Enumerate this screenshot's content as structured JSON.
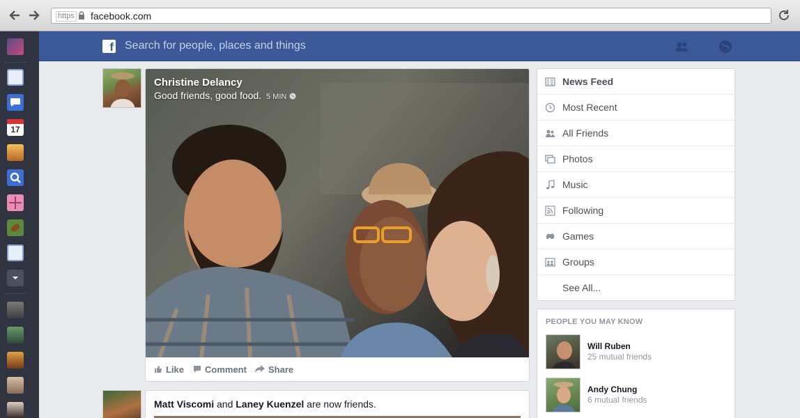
{
  "browser": {
    "url_scheme": "https",
    "url": "facebook.com"
  },
  "topbar": {
    "logo": "f",
    "search_placeholder": "Search for people, places and things",
    "friends_icon": "friend-requests-icon",
    "globe_icon": "notifications-globe-icon"
  },
  "dock": {
    "calendar_day": "17"
  },
  "story": {
    "author": "Christine Delancy",
    "text": "Good friends, good food.",
    "time": "5 MIN",
    "actions": [
      "Like",
      "Comment",
      "Share"
    ]
  },
  "story2": {
    "name1": "Matt Viscomi",
    "conjunction": "and",
    "name2": "Laney Kuenzel",
    "suffix": "are now friends."
  },
  "right_nav": {
    "items": [
      {
        "label": "News Feed",
        "icon": "news-feed-icon"
      },
      {
        "label": "Most Recent",
        "icon": "clock-icon"
      },
      {
        "label": "All Friends",
        "icon": "friends-icon"
      },
      {
        "label": "Photos",
        "icon": "photos-icon"
      },
      {
        "label": "Music",
        "icon": "music-note-icon"
      },
      {
        "label": "Following",
        "icon": "rss-icon"
      },
      {
        "label": "Games",
        "icon": "gamepad-icon"
      },
      {
        "label": "Groups",
        "icon": "groups-icon"
      },
      {
        "label": "See All...",
        "icon": ""
      }
    ]
  },
  "pymk": {
    "title": "PEOPLE YOU MAY KNOW",
    "people": [
      {
        "name": "Will Ruben",
        "mutual": "25 mutual friends"
      },
      {
        "name": "Andy Chung",
        "mutual": "6 mutual friends"
      }
    ]
  },
  "colors": {
    "brand": "#3b5998",
    "dock": "#2f3440",
    "background": "#e9eaed"
  }
}
